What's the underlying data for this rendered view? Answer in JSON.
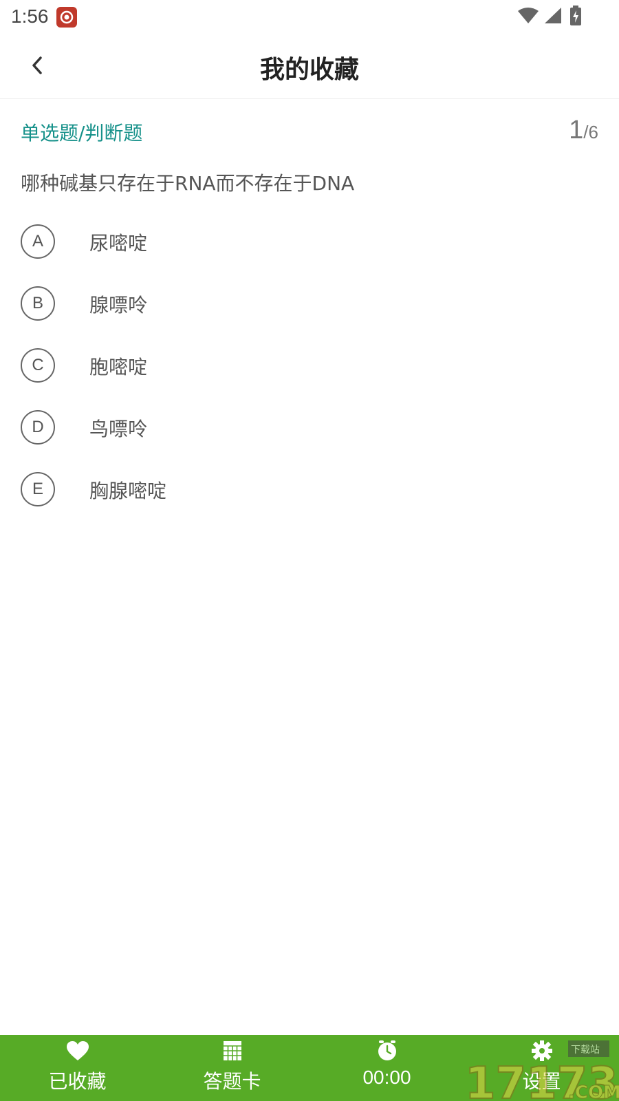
{
  "status_bar": {
    "time": "1:56",
    "icons": [
      "app-notification-icon",
      "wifi-icon",
      "signal-icon",
      "battery-icon"
    ]
  },
  "header": {
    "title": "我的收藏",
    "back_icon": "chevron-left-icon"
  },
  "question": {
    "type": "单选题/判断题",
    "counter_current": "1",
    "counter_separator": "/",
    "counter_total": "6",
    "text": "哪种碱基只存在于RNA而不存在于DNA",
    "options": [
      {
        "letter": "A",
        "text": "尿嘧啶"
      },
      {
        "letter": "B",
        "text": "腺嘌呤"
      },
      {
        "letter": "C",
        "text": "胞嘧啶"
      },
      {
        "letter": "D",
        "text": "鸟嘌呤"
      },
      {
        "letter": "E",
        "text": "胸腺嘧啶"
      }
    ]
  },
  "bottom_bar": {
    "favorited": {
      "label": "已收藏",
      "icon": "heart-icon"
    },
    "answer_card": {
      "label": "答题卡",
      "icon": "grid-icon"
    },
    "timer": {
      "label": "00:00",
      "icon": "clock-icon"
    },
    "settings": {
      "label": "设置",
      "icon": "gear-icon"
    }
  },
  "colors": {
    "accent_teal": "#16918a",
    "bottom_bar_green": "#57ab26",
    "text_gray": "#555555"
  }
}
